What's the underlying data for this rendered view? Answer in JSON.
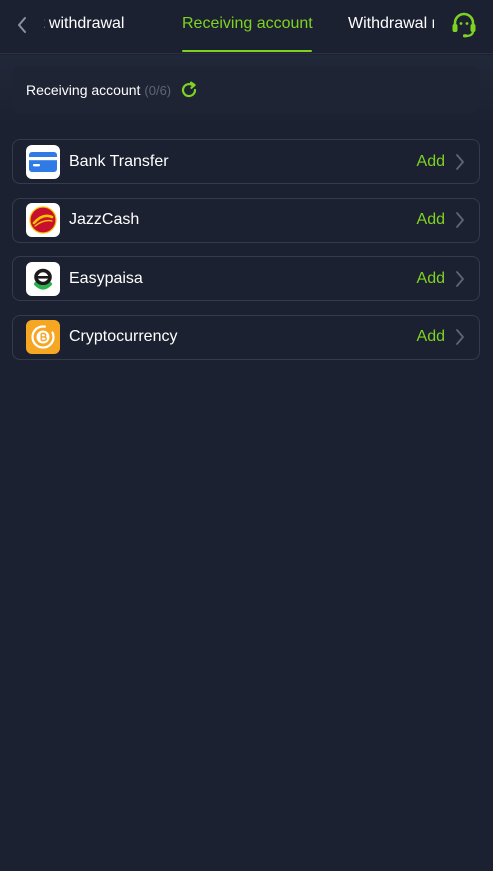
{
  "header": {
    "tabs": [
      {
        "label": "t withdrawal"
      },
      {
        "label": "Receiving account"
      },
      {
        "label": "Withdrawal r"
      }
    ],
    "active_color": "#7ed321"
  },
  "summary": {
    "label": "Receiving account",
    "count": "(0/6)"
  },
  "accounts": [
    {
      "name": "Bank Transfer",
      "action": "Add",
      "icon": "bank-card-icon"
    },
    {
      "name": "JazzCash",
      "action": "Add",
      "icon": "jazzcash-logo"
    },
    {
      "name": "Easypaisa",
      "action": "Add",
      "icon": "easypaisa-logo"
    },
    {
      "name": "Cryptocurrency",
      "action": "Add",
      "icon": "crypto-coin-icon"
    }
  ],
  "colors": {
    "background": "#1b2130",
    "accent": "#7ed321",
    "muted": "#5d6578"
  }
}
